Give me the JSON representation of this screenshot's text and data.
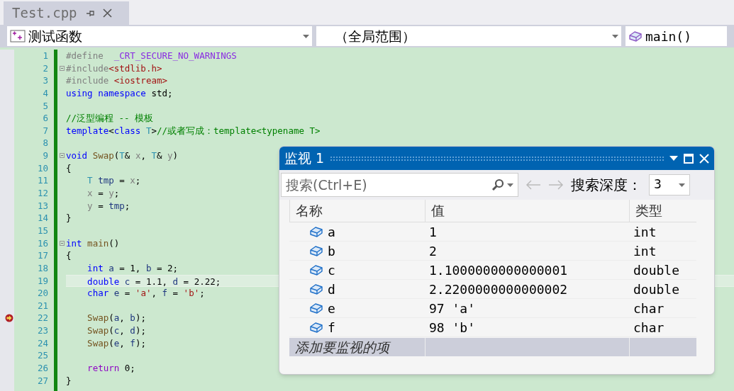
{
  "tab": {
    "title": "Test.cpp",
    "selected": true
  },
  "navigation": {
    "project": "测试函数",
    "scope": "（全局范围）",
    "member": "main()"
  },
  "editor": {
    "lines": [
      {
        "number": "1",
        "fold": false,
        "highlighted": false,
        "arrow": false,
        "tokens": [
          {
            "text": "#define  ",
            "kind": "pp"
          },
          {
            "text": "_CRT_SECURE_NO_WARNINGS",
            "kind": "macro"
          }
        ]
      },
      {
        "number": "2",
        "fold": true,
        "highlighted": false,
        "arrow": false,
        "tokens": [
          {
            "text": "#include",
            "kind": "pp"
          },
          {
            "text": "<stdlib.h>",
            "kind": "str"
          }
        ]
      },
      {
        "number": "3",
        "fold": false,
        "highlighted": false,
        "arrow": false,
        "tokens": [
          {
            "text": "#include ",
            "kind": "pp"
          },
          {
            "text": "<iostream>",
            "kind": "str"
          }
        ]
      },
      {
        "number": "4",
        "fold": false,
        "highlighted": false,
        "arrow": false,
        "tokens": [
          {
            "text": "using namespace",
            "kind": "kw"
          },
          {
            "text": " std;",
            "kind": "plain"
          }
        ]
      },
      {
        "number": "5",
        "fold": false,
        "highlighted": false,
        "arrow": false
      },
      {
        "number": "6",
        "fold": false,
        "highlighted": false,
        "arrow": false,
        "tokens": [
          {
            "text": "//泛型编程 -- 模板",
            "kind": "cmt"
          }
        ]
      },
      {
        "number": "7",
        "fold": false,
        "highlighted": false,
        "arrow": false,
        "tokens": [
          {
            "text": "template",
            "kind": "kw"
          },
          {
            "text": "<",
            "kind": "plain"
          },
          {
            "text": "class",
            "kind": "kw"
          },
          {
            "text": " T",
            "kind": "type"
          },
          {
            "text": ">",
            "kind": "plain"
          },
          {
            "text": "//或者写成：template<typename T>",
            "kind": "cmt"
          }
        ]
      },
      {
        "number": "8",
        "fold": false,
        "highlighted": false,
        "arrow": false
      },
      {
        "number": "9",
        "fold": true,
        "highlighted": false,
        "arrow": false,
        "tokens": [
          {
            "text": "void",
            "kind": "kw"
          },
          {
            "text": " Swap",
            "kind": "fn"
          },
          {
            "text": "(",
            "kind": "plain"
          },
          {
            "text": "T",
            "kind": "type"
          },
          {
            "text": "& ",
            "kind": "plain"
          },
          {
            "text": "x",
            "kind": "param"
          },
          {
            "text": ", ",
            "kind": "plain"
          },
          {
            "text": "T",
            "kind": "type"
          },
          {
            "text": "& ",
            "kind": "plain"
          },
          {
            "text": "y",
            "kind": "param"
          },
          {
            "text": ")",
            "kind": "plain"
          }
        ]
      },
      {
        "number": "10",
        "fold": false,
        "highlighted": false,
        "arrow": false,
        "tokens": [
          {
            "text": "{",
            "kind": "plain"
          }
        ]
      },
      {
        "number": "11",
        "fold": false,
        "highlighted": false,
        "arrow": false,
        "tokens": [
          {
            "text": "    T",
            "kind": "type"
          },
          {
            "text": " tmp",
            "kind": "var"
          },
          {
            "text": " = ",
            "kind": "plain"
          },
          {
            "text": "x",
            "kind": "param"
          },
          {
            "text": ";",
            "kind": "plain"
          }
        ]
      },
      {
        "number": "12",
        "fold": false,
        "highlighted": false,
        "arrow": false,
        "tokens": [
          {
            "text": "    x",
            "kind": "param"
          },
          {
            "text": " = ",
            "kind": "plain"
          },
          {
            "text": "y",
            "kind": "param"
          },
          {
            "text": ";",
            "kind": "plain"
          }
        ]
      },
      {
        "number": "13",
        "fold": false,
        "highlighted": false,
        "arrow": false,
        "tokens": [
          {
            "text": "    y",
            "kind": "param"
          },
          {
            "text": " = ",
            "kind": "plain"
          },
          {
            "text": "tmp",
            "kind": "var"
          },
          {
            "text": ";",
            "kind": "plain"
          }
        ]
      },
      {
        "number": "14",
        "fold": false,
        "highlighted": false,
        "arrow": false,
        "tokens": [
          {
            "text": "}",
            "kind": "plain"
          }
        ]
      },
      {
        "number": "15",
        "fold": false,
        "highlighted": false,
        "arrow": false
      },
      {
        "number": "16",
        "fold": true,
        "highlighted": false,
        "arrow": false,
        "tokens": [
          {
            "text": "int",
            "kind": "kw"
          },
          {
            "text": " main",
            "kind": "fn"
          },
          {
            "text": "()",
            "kind": "plain"
          }
        ]
      },
      {
        "number": "17",
        "fold": false,
        "highlighted": false,
        "arrow": false,
        "tokens": [
          {
            "text": "{",
            "kind": "plain"
          }
        ]
      },
      {
        "number": "18",
        "fold": false,
        "highlighted": false,
        "arrow": false,
        "tokens": [
          {
            "text": "    int",
            "kind": "kw"
          },
          {
            "text": " a",
            "kind": "var"
          },
          {
            "text": " = 1, ",
            "kind": "plain"
          },
          {
            "text": "b",
            "kind": "var"
          },
          {
            "text": " = 2;",
            "kind": "plain"
          }
        ]
      },
      {
        "number": "19",
        "fold": false,
        "highlighted": true,
        "arrow": false,
        "tokens": [
          {
            "text": "    double",
            "kind": "kw"
          },
          {
            "text": " c",
            "kind": "var"
          },
          {
            "text": " = 1.1, ",
            "kind": "plain"
          },
          {
            "text": "d",
            "kind": "var"
          },
          {
            "text": " = 2.22;",
            "kind": "plain"
          }
        ]
      },
      {
        "number": "20",
        "fold": false,
        "highlighted": false,
        "arrow": false,
        "tokens": [
          {
            "text": "    char",
            "kind": "kw"
          },
          {
            "text": " e",
            "kind": "var"
          },
          {
            "text": " = ",
            "kind": "plain"
          },
          {
            "text": "'a'",
            "kind": "str"
          },
          {
            "text": ", ",
            "kind": "plain"
          },
          {
            "text": "f",
            "kind": "var"
          },
          {
            "text": " = ",
            "kind": "plain"
          },
          {
            "text": "'b'",
            "kind": "str"
          },
          {
            "text": ";",
            "kind": "plain"
          }
        ]
      },
      {
        "number": "21",
        "fold": false,
        "highlighted": false,
        "arrow": false
      },
      {
        "number": "22",
        "fold": false,
        "highlighted": false,
        "arrow": true,
        "tokens": [
          {
            "text": "    Swap",
            "kind": "fn"
          },
          {
            "text": "(",
            "kind": "plain"
          },
          {
            "text": "a",
            "kind": "var"
          },
          {
            "text": ", ",
            "kind": "plain"
          },
          {
            "text": "b",
            "kind": "var"
          },
          {
            "text": ");",
            "kind": "plain"
          }
        ]
      },
      {
        "number": "23",
        "fold": false,
        "highlighted": false,
        "arrow": false,
        "tokens": [
          {
            "text": "    Swap",
            "kind": "fn"
          },
          {
            "text": "(",
            "kind": "plain"
          },
          {
            "text": "c",
            "kind": "var"
          },
          {
            "text": ", ",
            "kind": "plain"
          },
          {
            "text": "d",
            "kind": "var"
          },
          {
            "text": ");",
            "kind": "plain"
          }
        ]
      },
      {
        "number": "24",
        "fold": false,
        "highlighted": false,
        "arrow": false,
        "tokens": [
          {
            "text": "    Swap",
            "kind": "fn"
          },
          {
            "text": "(",
            "kind": "plain"
          },
          {
            "text": "e",
            "kind": "var"
          },
          {
            "text": ", ",
            "kind": "plain"
          },
          {
            "text": "f",
            "kind": "var"
          },
          {
            "text": ");",
            "kind": "plain"
          }
        ]
      },
      {
        "number": "25",
        "fold": false,
        "highlighted": false,
        "arrow": false
      },
      {
        "number": "26",
        "fold": false,
        "highlighted": false,
        "arrow": false,
        "tokens": [
          {
            "text": "    return",
            "kind": "ctrl"
          },
          {
            "text": " 0;",
            "kind": "plain"
          }
        ]
      },
      {
        "number": "27",
        "fold": false,
        "highlighted": false,
        "arrow": false,
        "tokens": [
          {
            "text": "}",
            "kind": "plain"
          }
        ]
      }
    ]
  },
  "watch": {
    "title": "监视 1",
    "search": {
      "placeholder": "搜索(Ctrl+E)"
    },
    "depth_label": "搜索深度：",
    "depth": "3",
    "columns": [
      "名称",
      "值",
      "类型"
    ],
    "rows": [
      {
        "name": "a",
        "value": "1",
        "type": "int"
      },
      {
        "name": "b",
        "value": "2",
        "type": "int"
      },
      {
        "name": "c",
        "value": "1.1000000000000001",
        "type": "double"
      },
      {
        "name": "d",
        "value": "2.2200000000000002",
        "type": "double"
      },
      {
        "name": "e",
        "value": "97 'a'",
        "type": "char"
      },
      {
        "name": "f",
        "value": "98 'b'",
        "type": "char"
      }
    ],
    "add_placeholder": "添加要监视的项"
  }
}
